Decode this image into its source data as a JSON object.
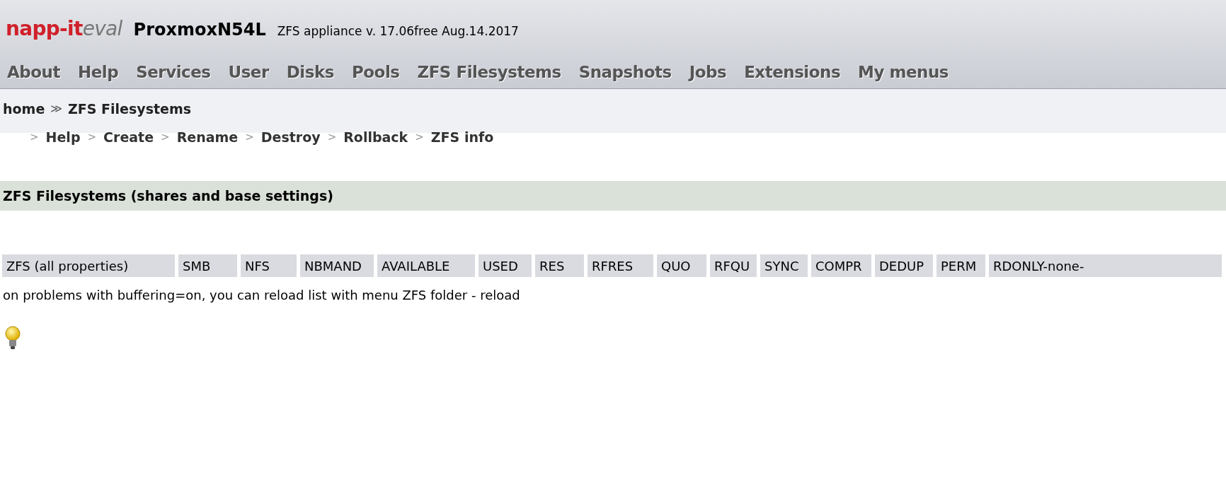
{
  "header": {
    "logo_main": "napp-it",
    "logo_suffix": "eval",
    "hostname": "ProxmoxN54L",
    "version": "ZFS appliance v. 17.06free Aug.14.2017"
  },
  "menu": [
    "About",
    "Help",
    "Services",
    "User",
    "Disks",
    "Pools",
    "ZFS Filesystems",
    "Snapshots",
    "Jobs",
    "Extensions",
    "My menus"
  ],
  "breadcrumb": {
    "home": "home",
    "separator": "≫",
    "current": "ZFS Filesystems"
  },
  "submenu": {
    "separator": ">",
    "items": [
      "Help",
      "Create",
      "Rename",
      "Destroy",
      "Rollback",
      "ZFS info"
    ]
  },
  "section_title": "ZFS Filesystems (shares and base settings)",
  "table": {
    "columns": [
      "ZFS (all properties)",
      "SMB",
      "NFS",
      "NBMAND",
      "AVAILABLE",
      "USED",
      "RES",
      "RFRES",
      "QUO",
      "RFQU",
      "SYNC",
      "COMPR",
      "DEDUP",
      "PERM",
      "RDONLY-none-"
    ]
  },
  "note": "on problems with buffering=on, you can reload list with menu ZFS folder - reload"
}
